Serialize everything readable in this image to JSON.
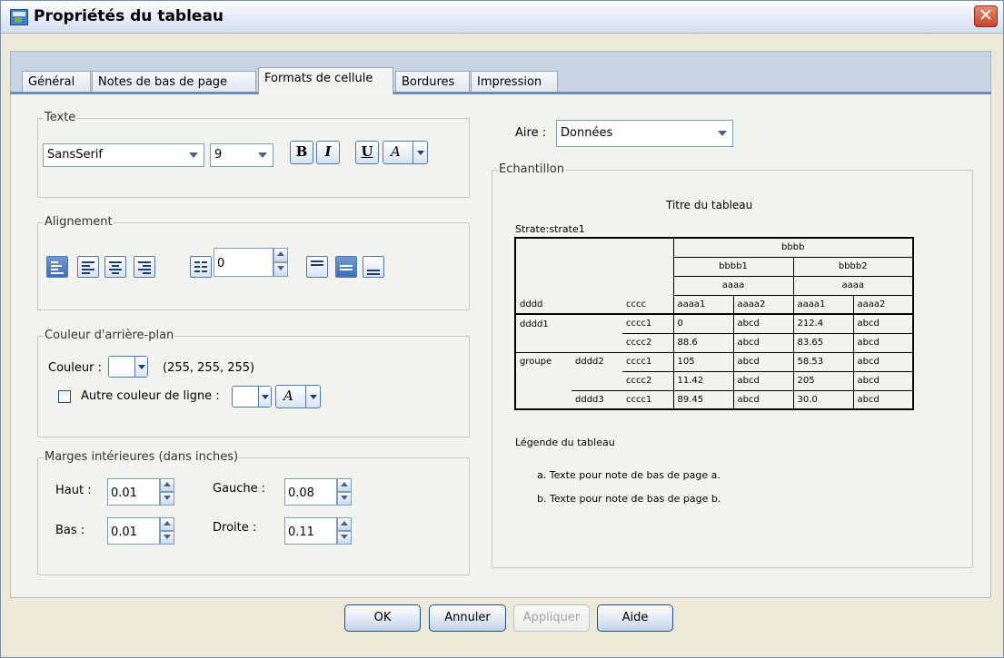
{
  "window": {
    "title": "Propriétés du tableau",
    "close_glyph": "✕"
  },
  "tabs": [
    {
      "label": "Général"
    },
    {
      "label": "Notes de bas de page"
    },
    {
      "label": "Formats de cellule"
    },
    {
      "label": "Bordures"
    },
    {
      "label": "Impression"
    }
  ],
  "active_tab": "Formats de cellule",
  "text_group": {
    "legend": "Texte",
    "font": "SansSerif",
    "size": "9",
    "bold": "B",
    "italic": "I",
    "underline": "U",
    "color_glyph": "A"
  },
  "alignment_group": {
    "legend": "Alignement",
    "indent": "0"
  },
  "background_group": {
    "legend": "Couleur d'arrière-plan",
    "color_label": "Couleur :",
    "rgb": "(255, 255, 255)",
    "alt_row_label": "Autre couleur de ligne :",
    "alt_row_checked": false,
    "color_glyph": "A",
    "swatch_color": "#ffffff"
  },
  "margins_group": {
    "legend": "Marges intérieures (dans inches)",
    "top_label": "Haut :",
    "top": "0.01",
    "bottom_label": "Bas :",
    "bottom": "0.01",
    "left_label": "Gauche :",
    "left": "0.08",
    "right_label": "Droite :",
    "right": "0.11"
  },
  "area": {
    "label": "Aire :",
    "value": "Données"
  },
  "sample": {
    "legend": "Echantillon",
    "title": "Titre du tableau",
    "layer": "Strate:strate1",
    "caption": "Légende du tableau",
    "footnotes": [
      "a. Texte pour note de bas de page a.",
      "b. Texte pour note de bas de page b."
    ],
    "table": {
      "top_header": "bbbb",
      "sub_headers": [
        "bbbb1",
        "bbbb2"
      ],
      "sub_sub": [
        "aaaa",
        "aaaa"
      ],
      "row_dim_labels": [
        "dddd",
        "cccc"
      ],
      "cols": [
        "aaaa1",
        "aaaa2",
        "aaaa1",
        "aaaa2"
      ],
      "rows": [
        {
          "g": "dddd1",
          "d": "",
          "c": "cccc1",
          "v": [
            "0",
            "abcd",
            "212.4",
            "abcd"
          ]
        },
        {
          "g": "",
          "d": "",
          "c": "cccc2",
          "v": [
            "88.6",
            "abcd",
            "83.65",
            "abcd"
          ]
        },
        {
          "g": "groupe",
          "d": "dddd2",
          "c": "cccc1",
          "v": [
            "105",
            "abcd",
            "58.53",
            "abcd"
          ]
        },
        {
          "g": "",
          "d": "",
          "c": "cccc2",
          "v": [
            "11.42",
            "abcd",
            "205",
            "abcd"
          ]
        },
        {
          "g": "",
          "d": "dddd3",
          "c": "cccc1",
          "v": [
            "89.45",
            "abcd",
            "30.0",
            "abcd"
          ]
        }
      ]
    }
  },
  "buttons": {
    "ok": "OK",
    "cancel": "Annuler",
    "apply": "Appliquer",
    "help": "Aide"
  }
}
